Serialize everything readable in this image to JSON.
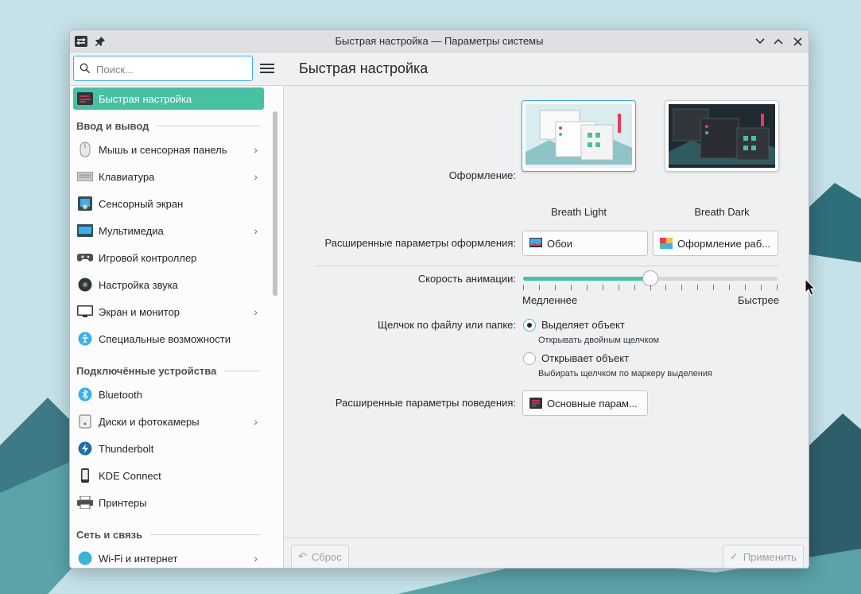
{
  "window": {
    "title": "Быстрая настройка — Параметры системы"
  },
  "search": {
    "placeholder": "Поиск..."
  },
  "sidebar": {
    "active_item": "Быстрая настройка",
    "sections": [
      "Ввод и вывод",
      "Подключённые устройства",
      "Сеть и связь"
    ],
    "items": [
      {
        "label": "Мышь и сенсорная панель",
        "icon": "mouse-icon",
        "has_arrow": true
      },
      {
        "label": "Клавиатура",
        "icon": "keyboard-icon",
        "has_arrow": true
      },
      {
        "label": "Сенсорный экран",
        "icon": "touchscreen-icon",
        "has_arrow": false
      },
      {
        "label": "Мультимедиа",
        "icon": "multimedia-icon",
        "has_arrow": true
      },
      {
        "label": "Игровой контроллер",
        "icon": "gamepad-icon",
        "has_arrow": false
      },
      {
        "label": "Настройка звука",
        "icon": "speaker-icon",
        "has_arrow": false
      },
      {
        "label": "Экран и монитор",
        "icon": "monitor-icon",
        "has_arrow": true
      },
      {
        "label": "Специальные возможности",
        "icon": "accessibility-icon",
        "has_arrow": false
      },
      {
        "label": "Bluetooth",
        "icon": "bluetooth-icon",
        "has_arrow": false
      },
      {
        "label": "Диски и фотокамеры",
        "icon": "disk-icon",
        "has_arrow": true
      },
      {
        "label": "Thunderbolt",
        "icon": "thunderbolt-icon",
        "has_arrow": false
      },
      {
        "label": "KDE Connect",
        "icon": "phone-icon",
        "has_arrow": false
      },
      {
        "label": "Принтеры",
        "icon": "printer-icon",
        "has_arrow": false
      },
      {
        "label": "Wi-Fi и интернет",
        "icon": "globe-icon",
        "has_arrow": true
      }
    ]
  },
  "main": {
    "title": "Быстрая настройка",
    "appearance_label": "Оформление:",
    "themes": [
      {
        "name": "Breath Light",
        "selected": true
      },
      {
        "name": "Breath Dark",
        "selected": false
      }
    ],
    "advanced_appearance_label": "Расширенные параметры оформления:",
    "wallpaper_button": "Обои",
    "workspace_theme_button": "Оформление раб...",
    "animation_label": "Скорость анимации:",
    "animation_slower": "Медленнее",
    "animation_faster": "Быстрее",
    "animation_speed_fraction": 0.5,
    "click_label": "Щелчок по файлу или папке:",
    "click_options": [
      {
        "label": "Выделяет объект",
        "hint": "Открывать двойным щелчком",
        "checked": true
      },
      {
        "label": "Открывает объект",
        "hint": "Выбирать щелчком по маркеру выделения",
        "checked": false
      }
    ],
    "advanced_behavior_label": "Расширенные параметры поведения:",
    "general_behavior_button": "Основные парам..."
  },
  "footer": {
    "reset_label": "Сброс",
    "apply_label": "Применить"
  },
  "colors": {
    "accent": "#48c0a2",
    "focus": "#3daee9"
  }
}
